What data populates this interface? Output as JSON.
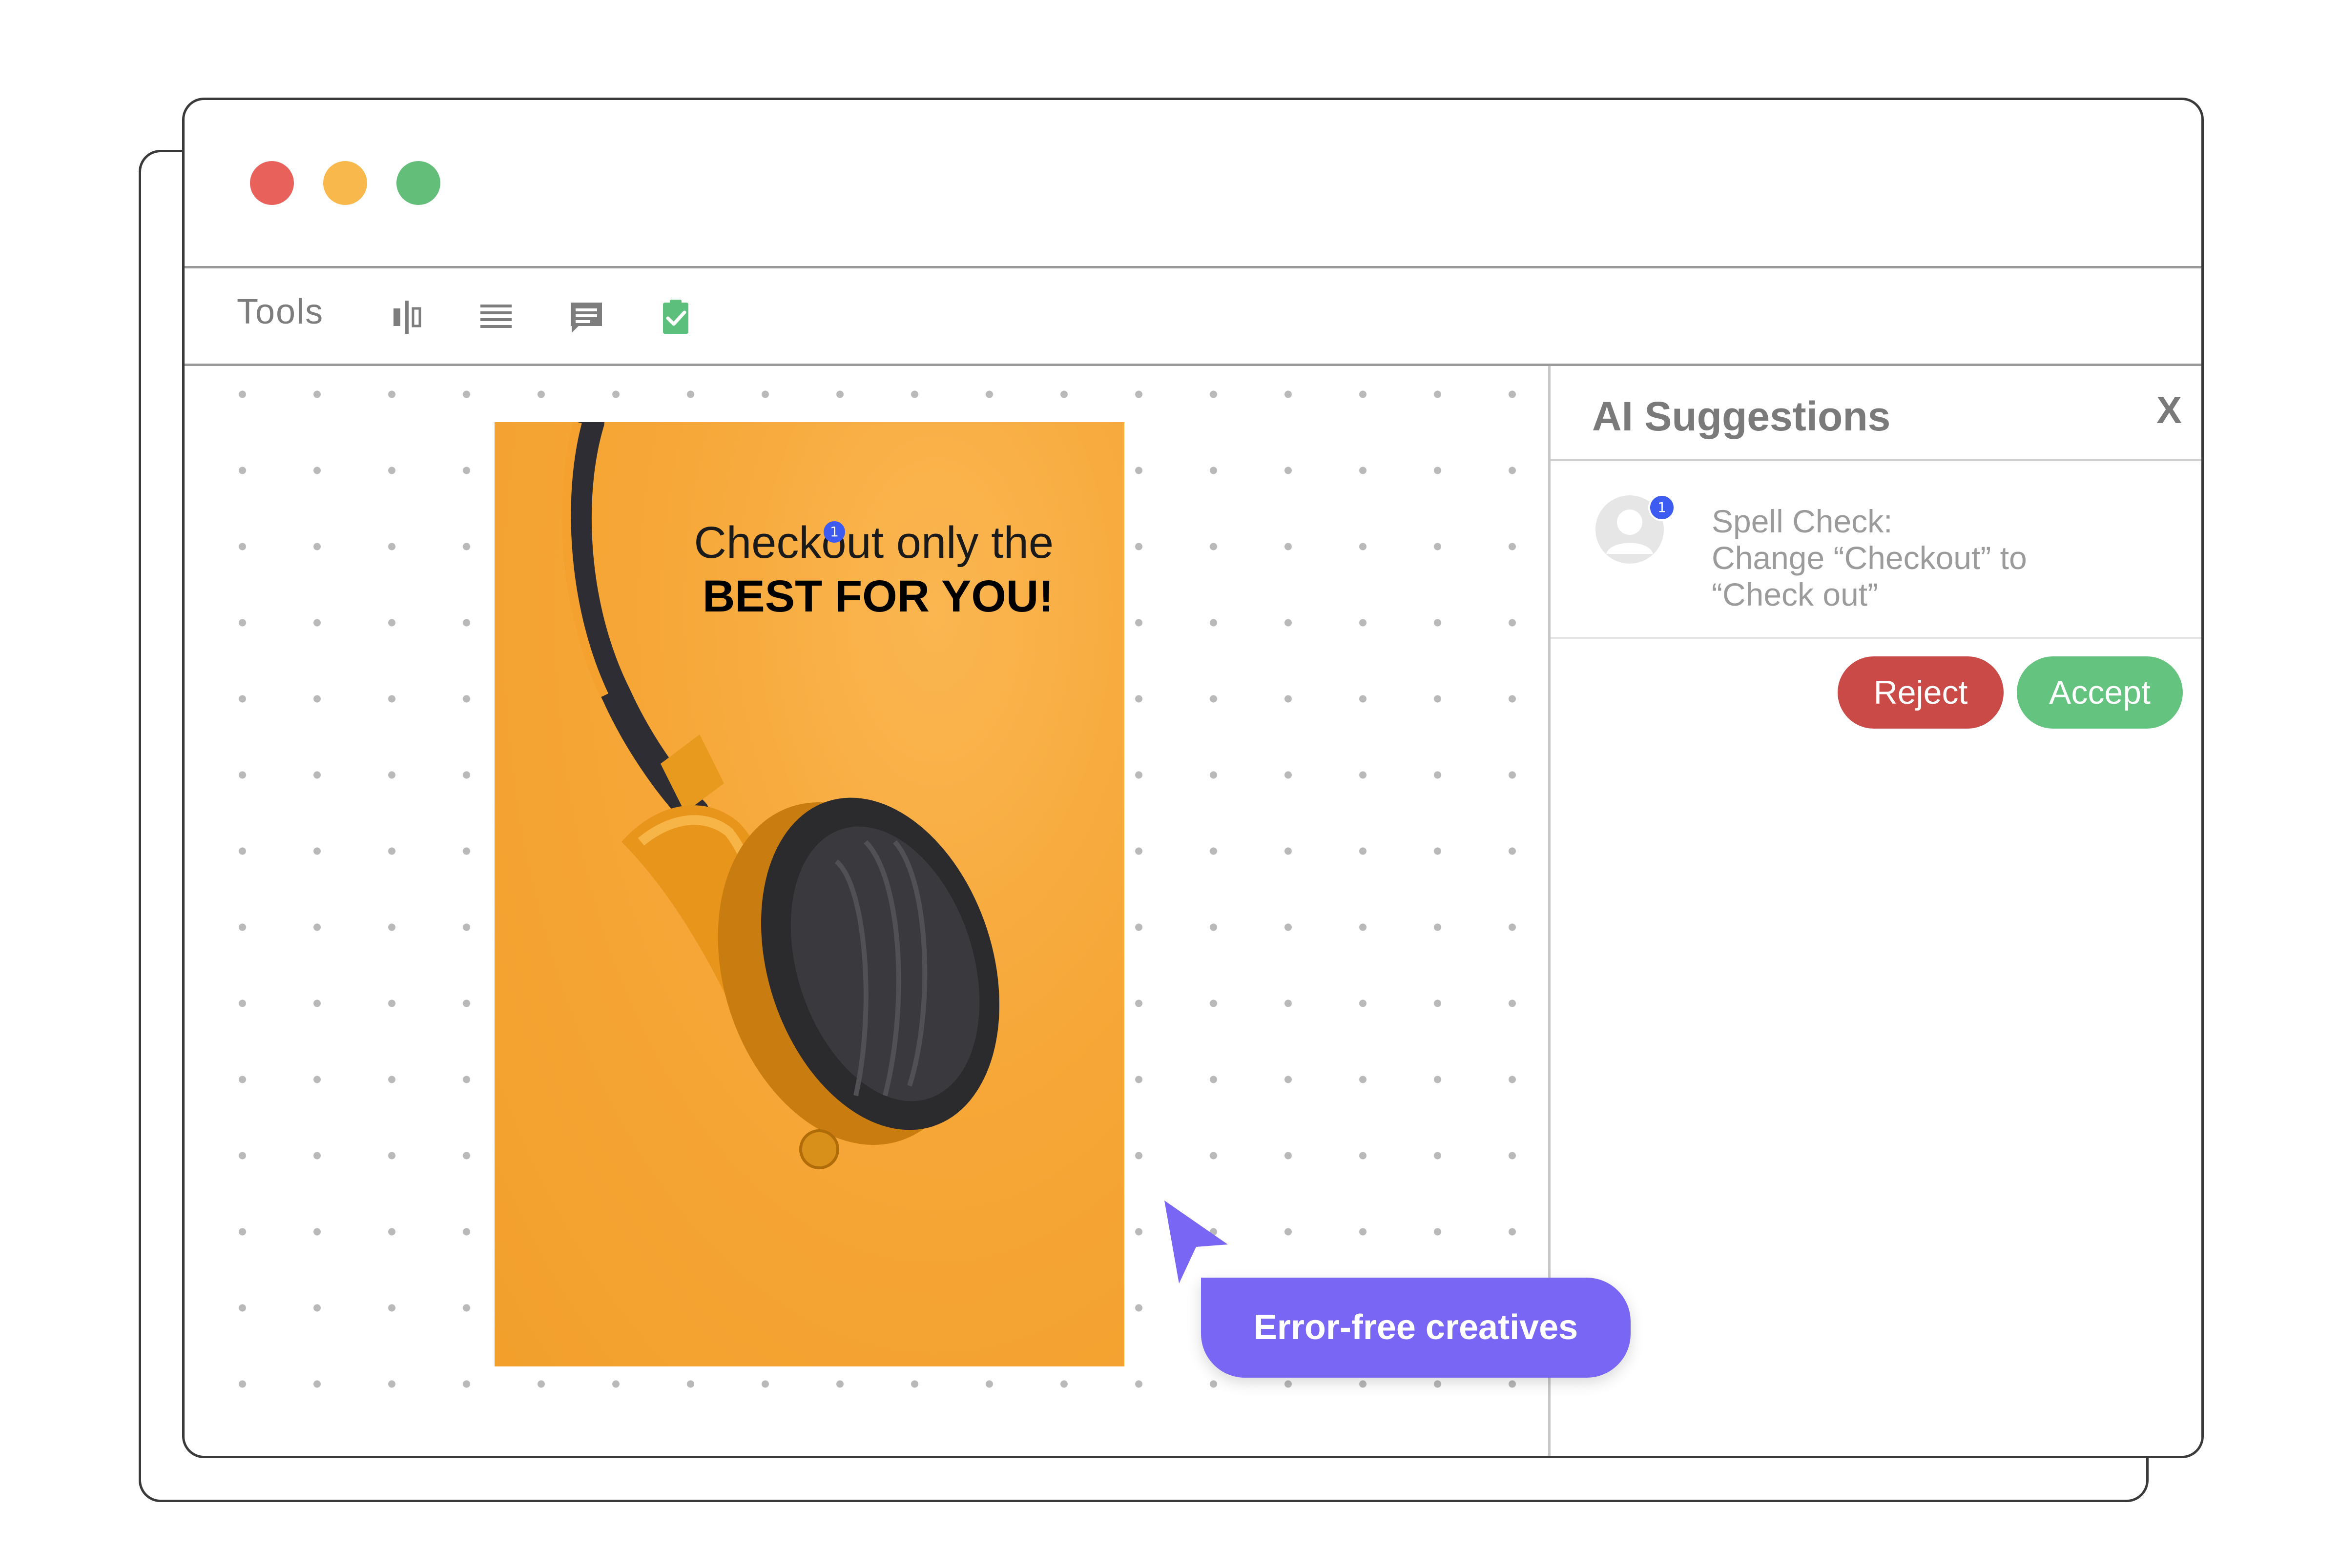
{
  "toolbar": {
    "tools_label": "Tools",
    "icons": [
      "align-distribute-icon",
      "text-lines-icon",
      "comment-icon",
      "clipboard-check-icon"
    ]
  },
  "creative": {
    "headline_line1": "Checkout only the",
    "headline_line2": "BEST FOR YOU!",
    "pin_badge": "1"
  },
  "panel": {
    "title": "AI Suggestions",
    "close_label": "X",
    "suggestion": {
      "badge": "1",
      "line1": "Spell Check:",
      "line2": "Change “Checkout” to",
      "line3": "“Check out”"
    },
    "reject_label": "Reject",
    "accept_label": "Accept"
  },
  "tooltip": {
    "text": "Error-free creatives"
  },
  "colors": {
    "reject": "#c94a47",
    "accept": "#64c37f",
    "accent": "#7a66f5",
    "badge": "#3d5af1",
    "creative_bg": "#f6a737"
  }
}
